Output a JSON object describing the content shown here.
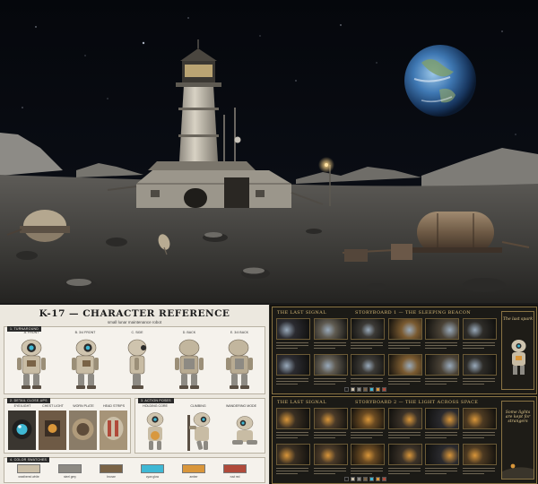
{
  "sheet": {
    "title": "K-17 — CHARACTER REFERENCE",
    "subtitle": "small lunar maintenance robot",
    "sections": {
      "turnaround": "1. TURNAROUND",
      "details": "2. DETAIL CLOSE-UPS",
      "poses": "3. ACTION POSES",
      "colors": "4. COLOR SWATCHES"
    },
    "views": [
      "A. FRONT",
      "B. 3/4 FRONT",
      "C. SIDE",
      "D. BACK",
      "E. 3/4 BACK"
    ],
    "detail_labels": [
      "EYE/LIGHT",
      "CHEST LIGHT",
      "WORN PLATE",
      "HEAD STRIPS"
    ],
    "pose_labels": [
      "HOLDING CORE",
      "CLIMBING",
      "WANDERING MODE"
    ],
    "swatches": [
      {
        "color": "#cbbfa8",
        "label": "weathered white"
      },
      {
        "color": "#8d8a83",
        "label": "steel grey"
      },
      {
        "color": "#7a6346",
        "label": "bronze"
      },
      {
        "color": "#3fb8d4",
        "label": "cyan glow"
      },
      {
        "color": "#d9963a",
        "label": "amber"
      },
      {
        "color": "#b04a3a",
        "label": "rust red"
      }
    ]
  },
  "storyboards": [
    {
      "series": "THE LAST SIGNAL",
      "title": "STORYBOARD 1 — THE SLEEPING BEACON",
      "side_text": "The last spark"
    },
    {
      "series": "THE LAST SIGNAL",
      "title": "STORYBOARD 2 — THE LIGHT ACROSS SPACE",
      "side_text": "Some lights are kept for strangers"
    }
  ]
}
